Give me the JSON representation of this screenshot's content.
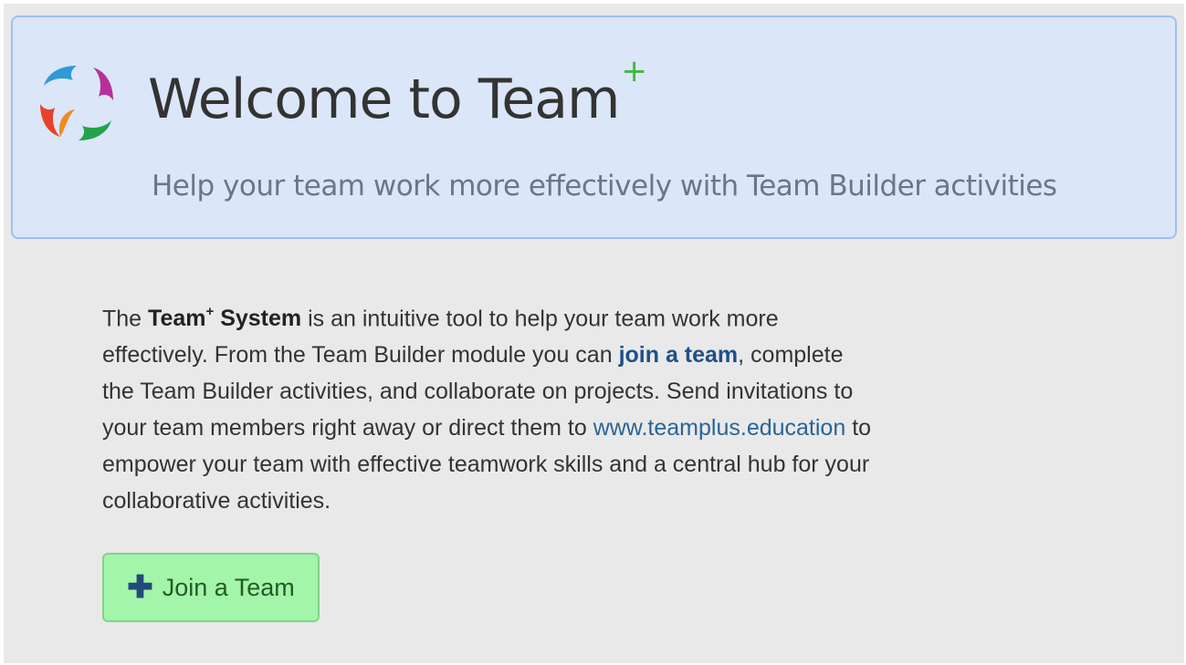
{
  "hero": {
    "title": "Welcome to Team",
    "title_sup": "+",
    "subtitle": "Help your team work more effectively with Team Builder activities"
  },
  "intro": {
    "p1": "The ",
    "brand": "Team",
    "brand_sup": "+",
    "brand_rest": " System",
    "p2": " is an intuitive tool to help your team work more effectively. From the Team Builder module you can ",
    "join_link": "join a team",
    "p3": ", complete the Team Builder activities, and collaborate on projects. Send invitations to your team members right away or direct them to ",
    "site_link": "www.teamplus.education",
    "p4": " to empower your team with effective teamwork skills and a central hub for your collaborative activities."
  },
  "join_button": {
    "icon": "plus-icon",
    "label": "Join a Team"
  },
  "colors": {
    "hero_bg": "#dbe6f8",
    "hero_border": "#9fbff0",
    "accent_green": "#3cb93c",
    "button_bg": "#a3f5a9",
    "link": "#1f4f8a"
  }
}
